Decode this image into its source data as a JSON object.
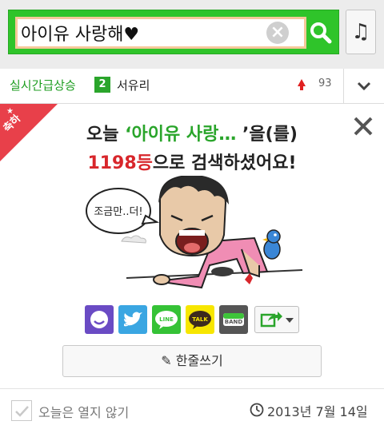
{
  "search": {
    "query": "아이유 사랑해♥",
    "clear_icon": "close-circle-icon",
    "search_icon": "magnifier-icon",
    "music_icon": "music-note-icon",
    "accent": "#2fc42a"
  },
  "ranking": {
    "title": "실시간급상승",
    "rank": "2",
    "name": "서유리",
    "trend": "up",
    "change": "93",
    "toggle_icon": "chevron-down-icon"
  },
  "card": {
    "ribbon": "축하",
    "line1_prefix": "오늘 ",
    "keyword": "‘아이유 사랑…",
    "line1_suffix": "  ’을(를)",
    "rank_text": "1198등",
    "line2_suffix": "으로 검색하셨어요!",
    "speech": "조금만..더!",
    "share": [
      {
        "name": "mypeople",
        "color": "#6a4bc4",
        "icon": "smile-face-icon"
      },
      {
        "name": "twitter",
        "color": "#3aa6e2",
        "icon": "bird-icon"
      },
      {
        "name": "line",
        "color": "#35c236",
        "icon": "line-icon",
        "label": "LINE"
      },
      {
        "name": "kakaotalk",
        "color": "#f7e600",
        "icon": "talk-bubble-icon",
        "label": "TALK"
      },
      {
        "name": "band",
        "color": "#555555",
        "icon": "band-icon",
        "label": "BAND"
      }
    ],
    "more_icon": "share-arrow-icon",
    "write_label": "한줄쓰기",
    "write_icon": "pencil-icon"
  },
  "footer": {
    "noshow_label": "오늘은 열지 않기",
    "date": "2013년 7월 14일",
    "clock_icon": "clock-icon"
  }
}
